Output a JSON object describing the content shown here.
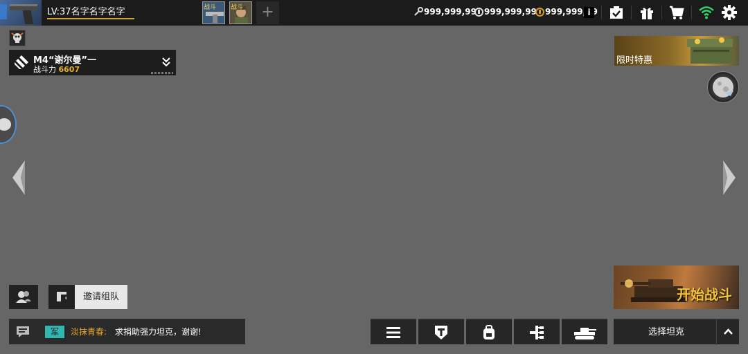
{
  "player": {
    "level_label": "LV:37名字名字名字"
  },
  "slots": [
    {
      "label": "战斗"
    },
    {
      "label": "战斗"
    }
  ],
  "add_slot_label": "+",
  "currencies": [
    {
      "icon": "key-icon",
      "value": "999,999,99"
    },
    {
      "icon": "silver-coin-icon",
      "value": "999,999,99"
    },
    {
      "icon": "gold-coin-icon",
      "value": "999,999,99"
    }
  ],
  "info_label": "i",
  "top_icons": [
    "mission-clipboard-icon",
    "gift-icon",
    "cart-icon",
    "wifi-icon",
    "gear-icon"
  ],
  "tank_card": {
    "name": "M4“谢尔曼”一",
    "power_label": "战斗力",
    "power_value": "6607"
  },
  "promo": {
    "label": "限时特惠"
  },
  "invite": {
    "label": "邀请组队"
  },
  "chat": {
    "tag": "军",
    "sender": "淡抹青春:",
    "message": "求捐助强力坦克，谢谢!"
  },
  "dock": [
    "menu-icon",
    "tech-tree-t-icon",
    "backpack-icon",
    "branch-tree-icon",
    "tank-icon"
  ],
  "start_battle": {
    "label": "开始战斗"
  },
  "select_tank": {
    "label": "选择坦克"
  },
  "colors": {
    "background": "#666666",
    "bar": "#1b1b1b",
    "accent_gold": "#e4b02a",
    "tag_teal": "#2fb7b0",
    "wifi_green": "#2fd36a"
  }
}
